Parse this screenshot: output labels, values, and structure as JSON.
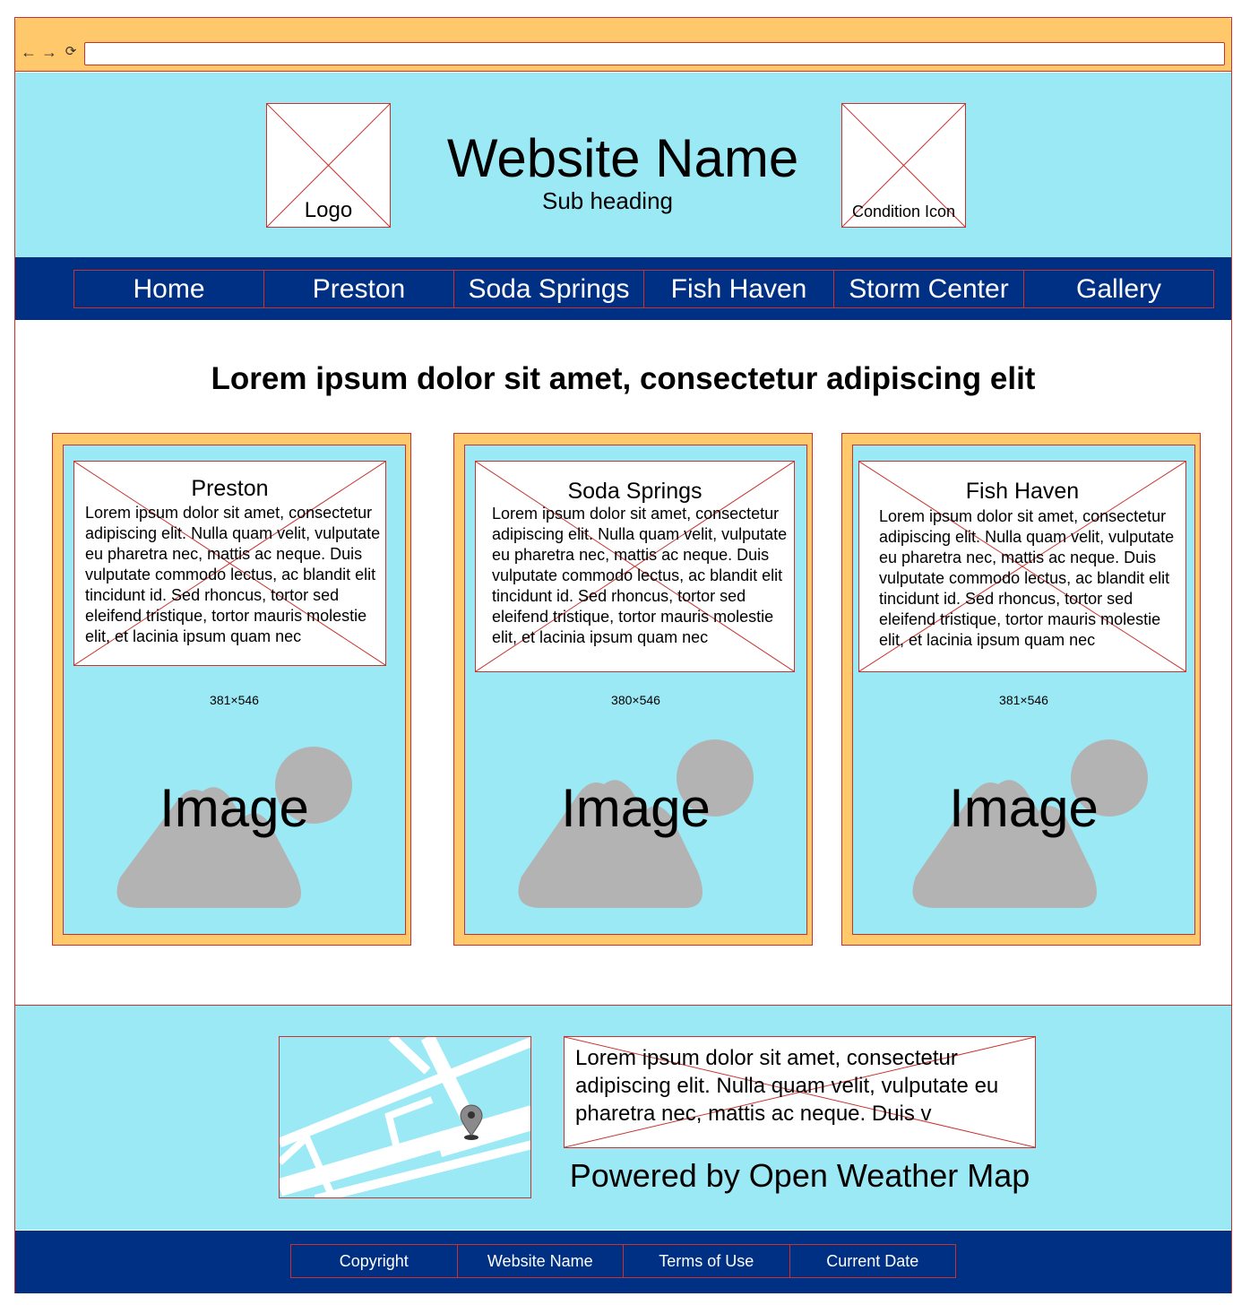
{
  "header": {
    "logo_label": "Logo",
    "title": "Website Name",
    "subtitle": "Sub heading",
    "condition_icon_label": "Condition Icon"
  },
  "nav": {
    "items": [
      {
        "label": "Home"
      },
      {
        "label": "Preston"
      },
      {
        "label": "Soda Springs"
      },
      {
        "label": "Fish Haven"
      },
      {
        "label": "Storm Center"
      },
      {
        "label": "Gallery"
      }
    ]
  },
  "main": {
    "heading": "Lorem ipsum dolor sit amet, consectetur adipiscing elit",
    "cards": [
      {
        "title": "Preston",
        "body": "Lorem ipsum dolor sit amet, consectetur adipiscing elit. Nulla quam velit, vulputate eu pharetra nec, mattis ac neque. Duis vulputate commodo lectus, ac blandit elit tincidunt id. Sed rhoncus, tortor sed eleifend tristique, tortor mauris molestie elit, et lacinia ipsum quam nec",
        "dimensions": "381×546",
        "image_label": "Image"
      },
      {
        "title": "Soda Springs",
        "body": "Lorem ipsum dolor sit amet, consectetur adipiscing elit. Nulla quam velit, vulputate eu pharetra nec, mattis ac neque. Duis vulputate commodo lectus, ac blandit elit tincidunt id. Sed rhoncus, tortor sed eleifend tristique, tortor mauris molestie elit, et lacinia ipsum quam nec",
        "dimensions": "380×546",
        "image_label": "Image"
      },
      {
        "title": "Fish Haven",
        "body": "Lorem ipsum dolor sit amet, consectetur adipiscing elit. Nulla quam velit, vulputate eu pharetra nec, mattis ac neque. Duis vulputate commodo lectus, ac blandit elit tincidunt id. Sed rhoncus, tortor sed eleifend tristique, tortor mauris molestie elit, et lacinia ipsum quam nec",
        "dimensions": "381×546",
        "image_label": "Image"
      }
    ]
  },
  "info": {
    "weather_text": "Lorem ipsum dolor sit amet, consectetur adipiscing elit. Nulla quam velit, vulputate eu pharetra nec, mattis ac neque. Duis v",
    "powered_by": "Powered by Open Weather Map"
  },
  "footer": {
    "items": [
      {
        "label": "Copyright"
      },
      {
        "label": "Website Name"
      },
      {
        "label": "Terms of Use"
      },
      {
        "label": "Current Date"
      }
    ]
  },
  "colors": {
    "chrome": "#ffc86b",
    "light_blue": "#9ce9f6",
    "navy": "#003083",
    "border_red": "#c8332f",
    "placeholder_gray": "#b3b3b3"
  },
  "icons": [
    "back-arrow-icon",
    "forward-arrow-icon",
    "reload-icon",
    "image-placeholder-icon",
    "map-pin-icon"
  ]
}
